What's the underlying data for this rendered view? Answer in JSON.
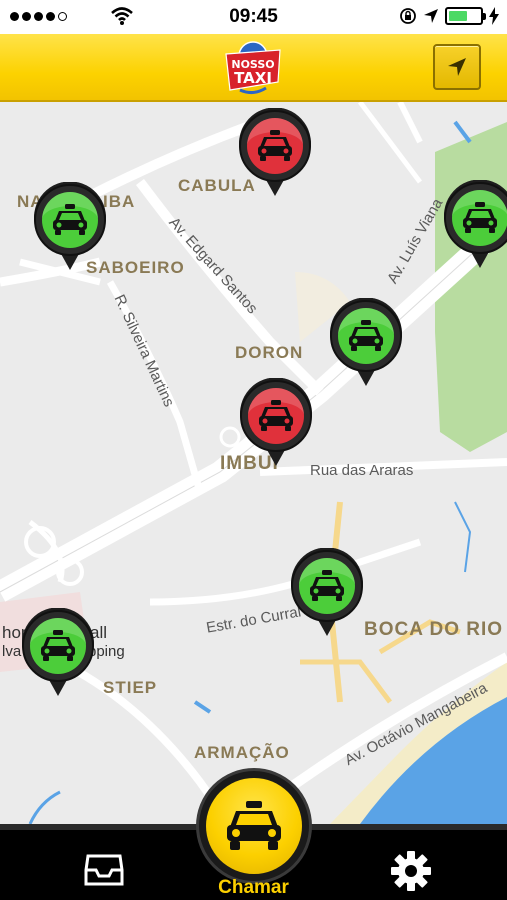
{
  "status_bar": {
    "time": "09:45",
    "signal_bars_filled": 4,
    "signal_bars_total": 5,
    "battery_level": 0.6,
    "icons": [
      "wifi-icon",
      "orientation-lock-icon",
      "location-arrow-icon",
      "battery-icon",
      "charging-bolt-icon"
    ]
  },
  "header": {
    "logo_text_top": "NOSSO",
    "logo_text_bottom": "TAXI",
    "locate_icon": "navigation-arrow-icon"
  },
  "map": {
    "neighborhoods": [
      "CABULA",
      "NA",
      "IBA",
      "SABOEIRO",
      "DORON",
      "IMBUÍ",
      "BOCA DO RIO",
      "STIEP",
      "ARMAÇÃO"
    ],
    "streets": [
      "Av. Edgard Santos",
      "Av. Luís Viana",
      "R. Silveira Martins",
      "Rua das Araras",
      "Estr. do Curral",
      "Av. Octávio Mangabeira"
    ],
    "poi_lines": [
      "hopp",
      "all",
      "lva",
      "pping"
    ],
    "taxis": [
      {
        "status": "unavailable",
        "color": "#e0313b"
      },
      {
        "status": "available",
        "color": "#4ccd3a"
      },
      {
        "status": "available",
        "color": "#4ccd3a"
      },
      {
        "status": "available",
        "color": "#4ccd3a"
      },
      {
        "status": "unavailable",
        "color": "#e0313b"
      },
      {
        "status": "available",
        "color": "#4ccd3a"
      },
      {
        "status": "available",
        "color": "#4ccd3a"
      }
    ]
  },
  "bottom_bar": {
    "call_label": "Chamar",
    "inbox_icon": "inbox-icon",
    "settings_icon": "gear-icon",
    "call_icon": "taxi-icon"
  },
  "colors": {
    "brand_yellow": "#fcd000",
    "available": "#4ccd3a",
    "unavailable": "#e0313b",
    "water": "#5aa3e6",
    "park": "#b8dca0"
  }
}
